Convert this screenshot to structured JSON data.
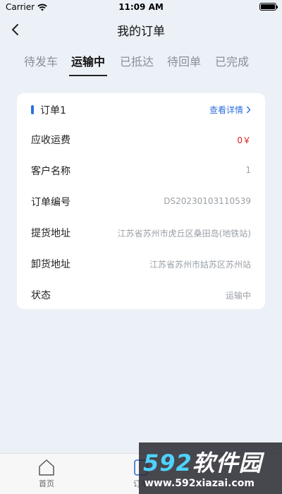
{
  "status_bar": {
    "carrier": "Carrier",
    "time": "11:09 AM"
  },
  "nav": {
    "title": "我的订单"
  },
  "tabs": [
    {
      "label": "待发车"
    },
    {
      "label": "运输中"
    },
    {
      "label": "已抵达"
    },
    {
      "label": "待回单"
    },
    {
      "label": "已完成"
    }
  ],
  "active_tab": "运输中",
  "order": {
    "title": "订单1",
    "detail_link": "查看详情",
    "rows": [
      {
        "label": "应收运费",
        "value": "0￥"
      },
      {
        "label": "客户名称",
        "value": "1"
      },
      {
        "label": "订单编号",
        "value": "DS20230103110539"
      },
      {
        "label": "提货地址",
        "value": "江苏省苏州市虎丘区桑田岛(地铁站)"
      },
      {
        "label": "卸货地址",
        "value": "江苏省苏州市姑苏区苏州站"
      },
      {
        "label": "状态",
        "value": "运输中"
      }
    ]
  },
  "bottom_nav": [
    {
      "label": "首页"
    },
    {
      "label": "订单"
    }
  ],
  "watermark": {
    "brand_num": "592",
    "brand_text": "软件园",
    "site": "www.592xiazai.com"
  },
  "colors": {
    "accent": "#2f6fdf",
    "fee": "#e02020",
    "background": "#ecf1f7"
  }
}
